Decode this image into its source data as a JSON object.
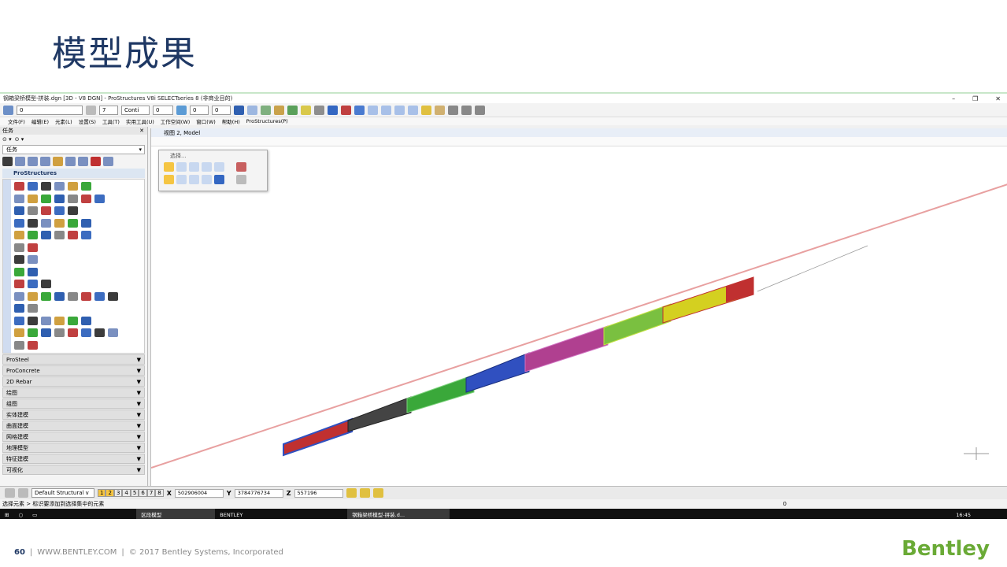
{
  "slide": {
    "title": "模型成果",
    "footer_page": "60",
    "footer_url": "WWW.BENTLEY.COM",
    "footer_copyright": "© 2017 Bentley Systems, Incorporated",
    "logo": "Bentley"
  },
  "window": {
    "title": "钢箱梁桥模型-拼装.dgn [3D - V8 DGN] - ProStructures V8i SELECTseries 8 (非商业目的)"
  },
  "toolbar": {
    "level_value": "0",
    "weight_value": "7",
    "style_value": "Conti",
    "priority_value": "0",
    "transparency_value": "0",
    "class_value": "0"
  },
  "menu": [
    "文件(F)",
    "编辑(E)",
    "元素(L)",
    "设置(S)",
    "工具(T)",
    "实用工具(U)",
    "工作空间(W)",
    "窗口(W)",
    "帮助(H)",
    "ProStructures(P)"
  ],
  "tasks_panel": {
    "header": "任务",
    "dropdown": "任务",
    "active_group": "ProStructures",
    "categories": [
      "ProSteel",
      "ProConcrete",
      "2D Rebar",
      "绘图",
      "组图",
      "实体建模",
      "曲面建模",
      "网格建模",
      "地理模型",
      "特征建模",
      "可视化"
    ]
  },
  "viewport": {
    "title": "视图 2, Model"
  },
  "select_tool": {
    "title": "选择..."
  },
  "status": {
    "view_tabs": [
      "1",
      "2",
      "3",
      "4",
      "5",
      "6",
      "7",
      "8"
    ],
    "view_group": "Default Structural v",
    "x_label": "X",
    "x_value": "502906004",
    "y_label": "Y",
    "y_value": "3784776734",
    "z_label": "Z",
    "z_value": "557196",
    "prompt": "选择元素 > 标识要添加到选择集中的元素",
    "right_value": "0"
  },
  "taskbar": {
    "items": [
      "区段模型",
      "BENTLEY",
      "钢箱梁桥模型-拼装.d..."
    ],
    "time": "16:45"
  },
  "colors": {
    "title_blue": "#1f3864",
    "logo_green": "#6aaa36",
    "axis_red": "#e8a0a0"
  }
}
